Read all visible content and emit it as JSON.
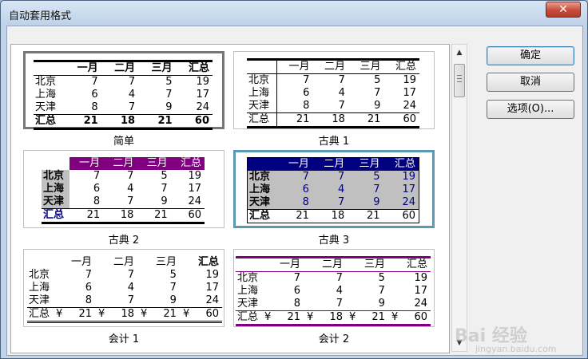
{
  "window": {
    "title": "自动套用格式"
  },
  "buttons": {
    "ok": "确定",
    "cancel": "取消",
    "options": "选项(O)..."
  },
  "preview": {
    "columns": [
      "",
      "一月",
      "二月",
      "三月",
      "汇总"
    ],
    "rows": [
      [
        "北京",
        "7",
        "7",
        "5",
        "19"
      ],
      [
        "上海",
        "6",
        "4",
        "7",
        "17"
      ],
      [
        "天津",
        "8",
        "7",
        "9",
        "24"
      ]
    ],
    "total": [
      "汇总",
      "21",
      "18",
      "21",
      "60"
    ],
    "currency": "¥"
  },
  "formats": [
    {
      "name": "简单"
    },
    {
      "name": "古典 1"
    },
    {
      "name": "古典 2"
    },
    {
      "name": "古典 3",
      "selected": true
    },
    {
      "name": "会计 1"
    },
    {
      "name": "会计 2"
    }
  ],
  "watermark": {
    "brand": "Bai 经验",
    "url": "jingyan.baidu.com"
  },
  "colors": {
    "purple": "#800080",
    "navy": "#000080",
    "gray": "#c0c0c0",
    "selection": "#5b9ab5"
  }
}
